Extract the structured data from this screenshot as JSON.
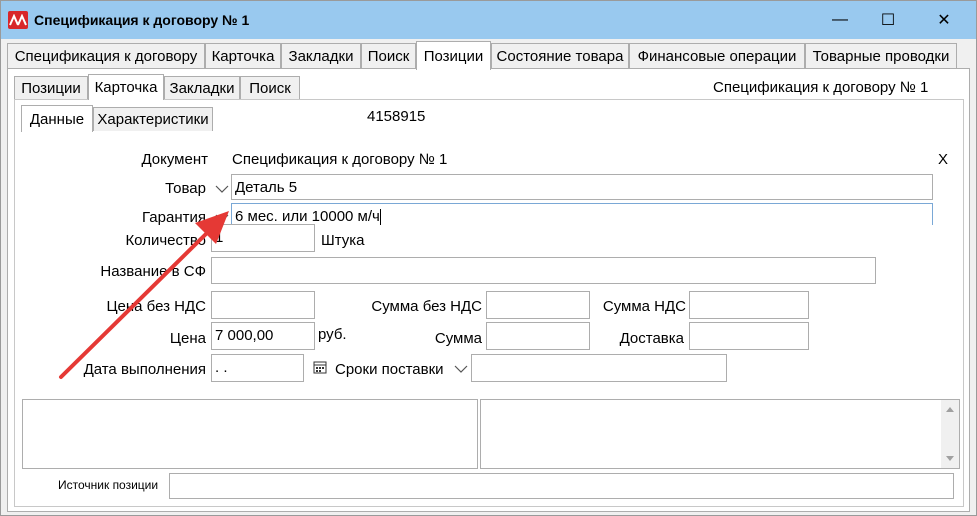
{
  "window": {
    "title": "Спецификация к договору № 1",
    "minimize": "—",
    "maximize": "☐",
    "close": "✕"
  },
  "main_tabs": [
    {
      "label": "Спецификация к договору"
    },
    {
      "label": "Карточка"
    },
    {
      "label": "Закладки"
    },
    {
      "label": "Поиск"
    },
    {
      "label": "Позиции"
    },
    {
      "label": "Состояние товара"
    },
    {
      "label": "Финансовые операции"
    },
    {
      "label": "Товарные проводки"
    }
  ],
  "sub_tabs": [
    {
      "label": "Позиции"
    },
    {
      "label": "Карточка"
    },
    {
      "label": "Закладки"
    },
    {
      "label": "Поиск"
    }
  ],
  "header_right": "Спецификация к договору № 1",
  "inner_tabs": [
    {
      "label": "Данные"
    },
    {
      "label": "Характеристики"
    }
  ],
  "record_id": "4158915",
  "form": {
    "document_label": "Документ",
    "document_value": "Спецификация к договору № 1",
    "close_x": "X",
    "product_label": "Товар",
    "product_value": "Деталь 5",
    "warranty_label": "Гарантия",
    "warranty_value": "6 мес. или 10000 м/ч",
    "quantity_label": "Количество",
    "quantity_value": "1",
    "unit": "Штука",
    "sf_name_label": "Название в СФ",
    "sf_name_value": "",
    "price_novat_label": "Цена без НДС",
    "price_novat_value": "",
    "sum_novat_label": "Сумма без НДС",
    "sum_novat_value": "",
    "vat_sum_label": "Сумма НДС",
    "vat_sum_value": "",
    "price_label": "Цена",
    "price_value": "7 000,00",
    "currency": "руб.",
    "sum_label": "Сумма",
    "sum_value": "",
    "delivery_label": "Доставка",
    "delivery_value": "",
    "due_date_label": "Дата выполнения",
    "due_date_value": " .  .",
    "delivery_terms_label": "Сроки поставки",
    "delivery_terms_value": "",
    "source_label": "Источник позиции",
    "source_value": ""
  },
  "colors": {
    "titlebar": "#99c9ef",
    "app_icon": "#d8262a",
    "annotation_arrow": "#e53935"
  }
}
